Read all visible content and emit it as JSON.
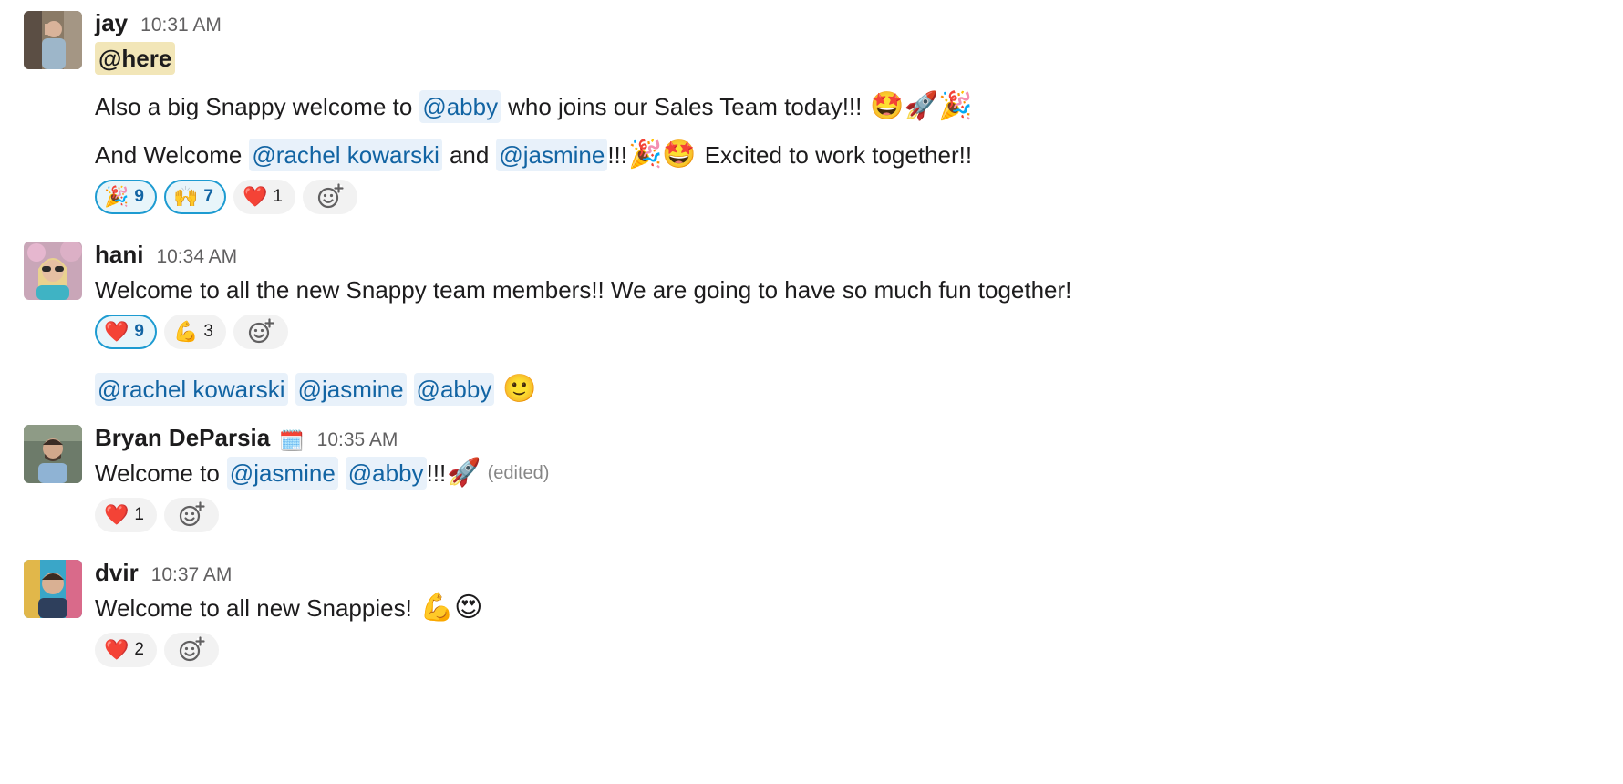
{
  "messages": [
    {
      "author": "jay",
      "time": "10:31 AM",
      "mention_here": "@here",
      "line1": {
        "before": "Also a big Snappy welcome to",
        "mention": "@abby",
        "after": "who joins our Sales Team today!!!",
        "emoji": "🤩🚀🎉"
      },
      "line2": {
        "before": "And Welcome",
        "mention1": "@rachel kowarski",
        "and": "and",
        "mention2": "@jasmine",
        "bang": "!!!",
        "emoji": "🎉🤩",
        "after": "Excited to work together!!"
      },
      "reactions": [
        {
          "emoji": "🎉",
          "count": "9",
          "active": true
        },
        {
          "emoji": "🙌",
          "count": "7",
          "active": true
        },
        {
          "emoji": "❤️",
          "count": "1",
          "active": false
        }
      ]
    },
    {
      "author": "hani",
      "time": "10:34 AM",
      "text": "Welcome to all the new Snappy team members!! We are going to have so much fun together!",
      "reactions": [
        {
          "emoji": "❤️",
          "count": "9",
          "active": true
        },
        {
          "emoji": "💪",
          "count": "3",
          "active": false
        }
      ],
      "followup": {
        "mentions": [
          "@rachel kowarski",
          "@jasmine",
          "@abby"
        ],
        "emoji": "🙂"
      }
    },
    {
      "author": "Bryan DeParsia",
      "status_emoji": "🗓️",
      "time": "10:35 AM",
      "before": "Welcome to",
      "mentions": [
        "@jasmine",
        "@abby"
      ],
      "after": "!!!",
      "emoji": "🚀",
      "edited": "(edited)",
      "reactions": [
        {
          "emoji": "❤️",
          "count": "1",
          "active": false
        }
      ]
    },
    {
      "author": "dvir",
      "time": "10:37 AM",
      "text": "Welcome to all new Snappies!",
      "emoji": "💪😍",
      "reactions": [
        {
          "emoji": "❤️",
          "count": "2",
          "active": false
        }
      ]
    }
  ],
  "icons": {
    "add_reaction": "add-reaction-icon"
  }
}
